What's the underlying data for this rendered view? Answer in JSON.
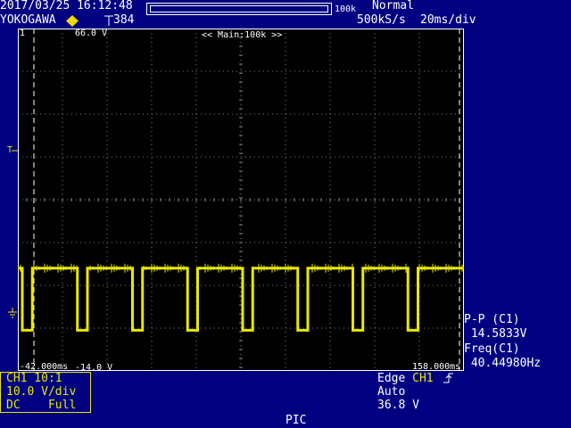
{
  "header": {
    "datetime": "2017/03/25 16:12:48",
    "brand": "YOKOGAWA",
    "record_label": "384",
    "zoom_label": "100k",
    "mode": "Normal",
    "sample_rate": "500kS/s",
    "timebase": "20ms/div"
  },
  "screen": {
    "channel_marker": "1",
    "upper_voltage": "66.0 V",
    "main_label": "<< Main:100k >>",
    "left_time": "-42.000ms",
    "lower_voltage": "-14.0 V",
    "right_time": "158.000ms",
    "trigger_marker": "T",
    "ground_marker": "1"
  },
  "channel": {
    "line1": "CH1 10:1",
    "line2": "10.0 V/div",
    "line3": "DC    Full"
  },
  "trigger": {
    "line1_prefix": "Edge ",
    "line1_channel": "CH1",
    "line2": "Auto",
    "line3": "36.8 V"
  },
  "measurements": {
    "pp_label": "P-P (C1)",
    "pp_value": " 14.5833V",
    "freq_label": "Freq(C1)",
    "freq_value": " 40.44980Hz"
  },
  "footer": {
    "label": "PIC"
  },
  "colors": {
    "background": "#000080",
    "screen": "#000000",
    "trace": "#e8e800",
    "grid": "#808080"
  },
  "waveform": {
    "description_units": "ms",
    "high_level_v": 10.0,
    "low_level_v": -4.5,
    "period_ms": 24.72,
    "low_pulse_starts_ms": [
      -40.0,
      -15.3,
      9.4,
      34.1,
      58.8,
      83.5,
      108.2,
      132.9
    ],
    "low_pulse_width_ms": 4.5
  }
}
